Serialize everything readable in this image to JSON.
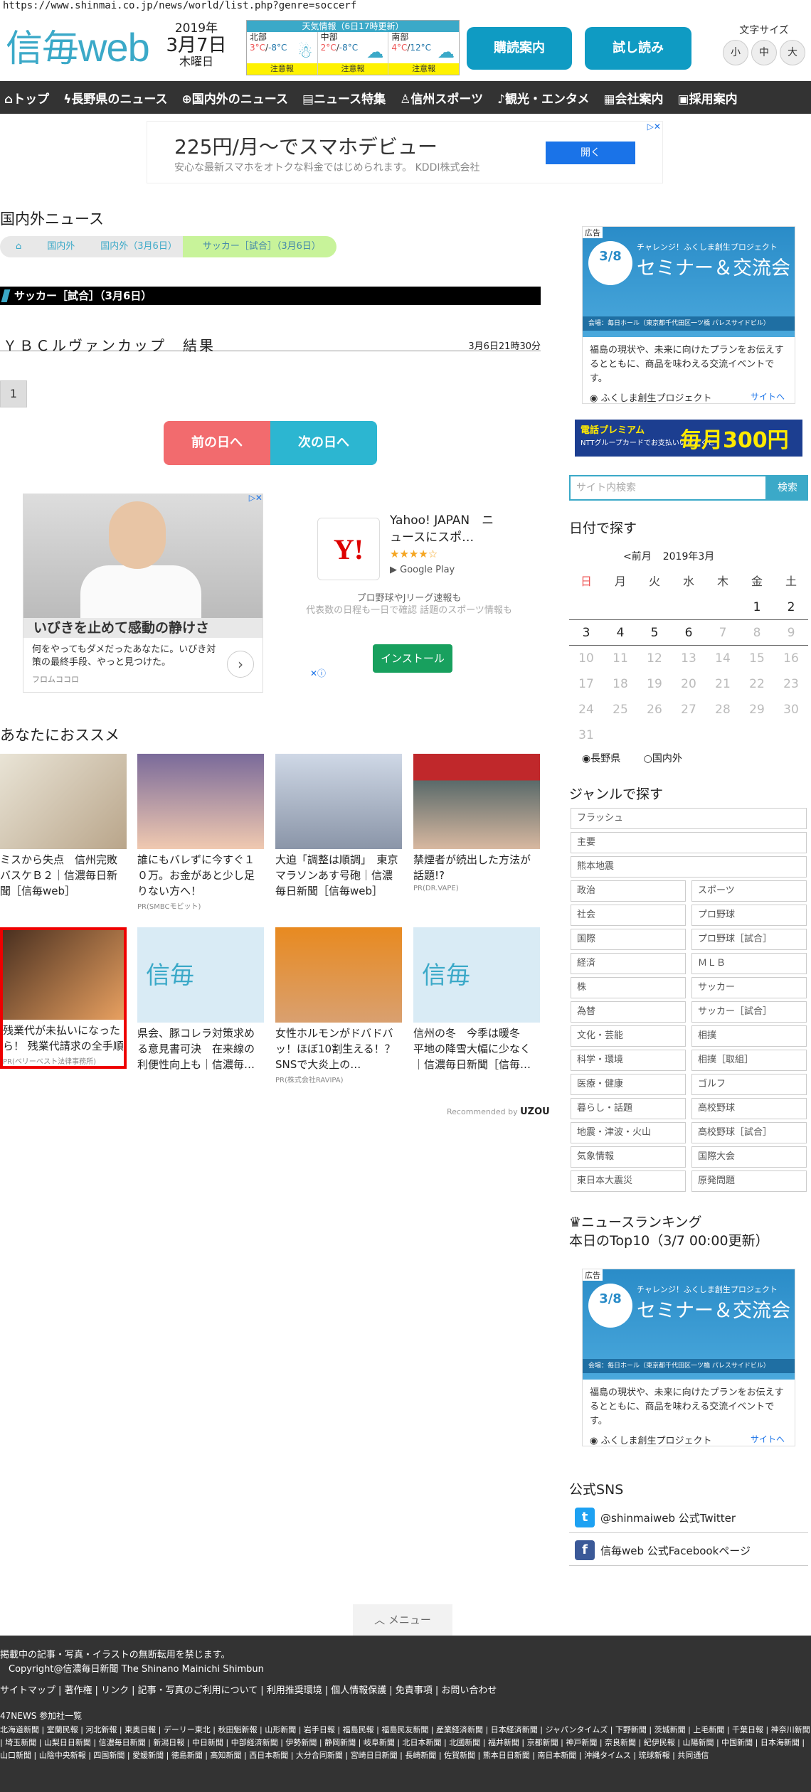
{
  "url": "https://www.shinmai.co.jp/news/world/list.php?genre=soccerf",
  "header": {
    "logo_kanji": "信毎",
    "logo_latin": "web",
    "year": "2019年",
    "monthday": "3月7日",
    "weekday": "木曜日",
    "weather_title": "天気情報（6日17時更新）",
    "weather": [
      {
        "region": "北部",
        "hi": "3°C",
        "lo": "-8°C",
        "warn": "注意報"
      },
      {
        "region": "中部",
        "hi": "2°C",
        "lo": "-8°C",
        "warn": "注意報"
      },
      {
        "region": "南部",
        "hi": "4°C",
        "lo": "12°C",
        "warn": "注意報"
      }
    ],
    "subscribe": "購読案内",
    "trial": "試し読み",
    "fontsize_label": "文字サイズ",
    "fontsizes": [
      "小",
      "中",
      "大"
    ]
  },
  "nav": [
    "トップ",
    "長野県のニュース",
    "国内外のニュース",
    "ニュース特集",
    "信州スポーツ",
    "観光・エンタメ",
    "会社案内",
    "採用案内"
  ],
  "ad_top": {
    "title": "225円/月〜でスマホデビュー",
    "sub": "安心な最新スマホをオトクな料金ではじめられます。 KDDI株式会社",
    "button": "開く"
  },
  "section_title": "国内外ニュース",
  "breadcrumbs": [
    "国内外",
    "国内外（3月6日）",
    "サッカー［試合］（3月6日）"
  ],
  "category_bar": "サッカー［試合］（3月6日）",
  "article": {
    "title": "ＹＢＣルヴァンカップ　結果",
    "time": "3月6日21時30分"
  },
  "pagination": "1",
  "prev_day": "前の日へ",
  "next_day": "次の日へ",
  "ad_mid": {
    "caption": "いびきを止めて感動の静けさ",
    "desc": "何をやってもダメだったあなたに。いびき対策の最終手段、やっと見つけた。",
    "source": "フロムココロ"
  },
  "ad_yahoo": {
    "logo": "Y!",
    "name": "Yahoo! JAPAN　ニュースにスポ…",
    "stars": "★★★★☆",
    "store": "Google Play",
    "desc1": "プロ野球やJリーグ速報も",
    "desc2": "代表数の日程も一日で確認 話題のスポーツ情報も",
    "install": "インストール"
  },
  "recommend_title": "あなたにおススメ",
  "recommend": [
    {
      "title": "ミスから失点　信州完敗　バスケＢ２｜信濃毎日新聞［信毎web］",
      "pr": ""
    },
    {
      "title": "誰にもバレずに今すぐ１０万。お金があと少し足りない方へ！",
      "pr": "PR(SMBCモビット)"
    },
    {
      "title": "大迫「調整は順調」　東京マラソンあす号砲｜信濃毎日新聞［信毎web］",
      "pr": ""
    },
    {
      "title": "禁煙者が続出した方法が話題!?",
      "pr": "PR(DR.VAPE)"
    },
    {
      "title": "残業代が未払いになったら！ 残業代請求の全手順",
      "pr": "PR(ベリーベスト法律事務所)"
    },
    {
      "title": "県会、豚コレラ対策求める意見書可決　在来線の利便性向上も｜信濃毎…",
      "pr": ""
    },
    {
      "title": "女性ホルモンがドバドバッ！ほぼ10割生える！？SNSで大炎上の…",
      "pr": "PR(株式会社RAVIPA)"
    },
    {
      "title": "信州の冬　今季は暖冬　平地の降雪大幅に少なく｜信濃毎日新聞［信毎…",
      "pr": ""
    }
  ],
  "recommended_by": "Recommended by",
  "recommended_brand": "UZOU",
  "sidebar_ad": {
    "tag": "広告",
    "date": "3/8",
    "small": "チャレンジ！ふくしま創生プロジェクト",
    "big": "セミナー＆交流会",
    "foot": "会場：毎日ホール（東京都千代田区一ツ橋 パレスサイドビル）",
    "body": "福島の現状や、未来に向けたプランをお伝えするとともに、商品を味わえる交流イベントです。",
    "org": "ふくしま創生プロジェクト",
    "more": "サイトへ"
  },
  "banner": {
    "p1": "電話プレミアム",
    "p2": "NTTグループカードでお支払いいただくと",
    "p3": "毎月300円"
  },
  "search": {
    "placeholder": "サイト内検索",
    "button": "検索"
  },
  "calendar": {
    "title": "日付で探す",
    "prev": "<前月",
    "month": "2019年3月",
    "weekdays": [
      "日",
      "月",
      "火",
      "水",
      "木",
      "金",
      "土"
    ],
    "weeks": [
      [
        "",
        "",
        "",
        "",
        "",
        "1",
        "2"
      ],
      [
        "3",
        "4",
        "5",
        "6",
        "7",
        "8",
        "9"
      ],
      [
        "10",
        "11",
        "12",
        "13",
        "14",
        "15",
        "16"
      ],
      [
        "17",
        "18",
        "19",
        "20",
        "21",
        "22",
        "23"
      ],
      [
        "24",
        "25",
        "26",
        "27",
        "28",
        "29",
        "30"
      ],
      [
        "31",
        "",
        "",
        "",
        "",
        "",
        ""
      ]
    ],
    "radio_a": "長野県",
    "radio_b": "国内外"
  },
  "genre_title": "ジャンルで探す",
  "genres_full": [
    "フラッシュ",
    "主要",
    "熊本地震"
  ],
  "genres_left": [
    "政治",
    "社会",
    "国際",
    "経済",
    "株",
    "為替",
    "文化・芸能",
    "科学・環境",
    "医療・健康",
    "暮らし・話題",
    "地震・津波・火山",
    "気象情報",
    "東日本大震災"
  ],
  "genres_right": [
    "スポーツ",
    "プロ野球",
    "プロ野球［試合］",
    "ＭＬＢ",
    "サッカー",
    "サッカー［試合］",
    "相撲",
    "相撲［取組］",
    "ゴルフ",
    "高校野球",
    "高校野球［試合］",
    "国際大会",
    "原発問題"
  ],
  "ranking_title": "♛ニュースランキング",
  "ranking_sub": "本日のTop10（3/7 00:00更新）",
  "sns_title": "公式SNS",
  "sns": [
    {
      "icon": "t",
      "label": "@shinmaiweb 公式Twitter"
    },
    {
      "icon": "f",
      "label": "信毎web 公式Facebookページ"
    }
  ],
  "menu": "メニュー",
  "footer": {
    "notice": "掲載中の記事・写真・イラストの無断転用を禁じます。",
    "copyright": "Copyright@信濃毎日新聞 The Shinano Mainichi Shimbun",
    "links": [
      "サイトマップ",
      "著作権",
      "リンク",
      "記事・写真のご利用について",
      "利用推奨環境",
      "個人情報保護",
      "免責事項",
      "お問い合わせ"
    ],
    "members_title": "47NEWS 参加社一覧",
    "members": [
      "北海道新聞",
      "室蘭民報",
      "河北新報",
      "東奥日報",
      "デーリー東北",
      "秋田魁新報",
      "山形新聞",
      "岩手日報",
      "福島民報",
      "福島民友新聞",
      "産業経済新聞",
      "日本経済新聞",
      "ジャパンタイムズ",
      "下野新聞",
      "茨城新聞",
      "上毛新聞",
      "千葉日報",
      "神奈川新聞",
      "埼玉新聞",
      "山梨日日新聞",
      "信濃毎日新聞",
      "新潟日報",
      "中日新聞",
      "中部経済新聞",
      "伊勢新聞",
      "静岡新聞",
      "岐阜新聞",
      "北日本新聞",
      "北國新聞",
      "福井新聞",
      "京都新聞",
      "神戸新聞",
      "奈良新聞",
      "紀伊民報",
      "山陽新聞",
      "中国新聞",
      "日本海新聞",
      "山口新聞",
      "山陰中央新報",
      "四国新聞",
      "愛媛新聞",
      "徳島新聞",
      "高知新聞",
      "西日本新聞",
      "大分合同新聞",
      "宮崎日日新聞",
      "長崎新聞",
      "佐賀新聞",
      "熊本日日新聞",
      "南日本新聞",
      "沖縄タイムス",
      "琉球新報",
      "共同通信"
    ]
  }
}
